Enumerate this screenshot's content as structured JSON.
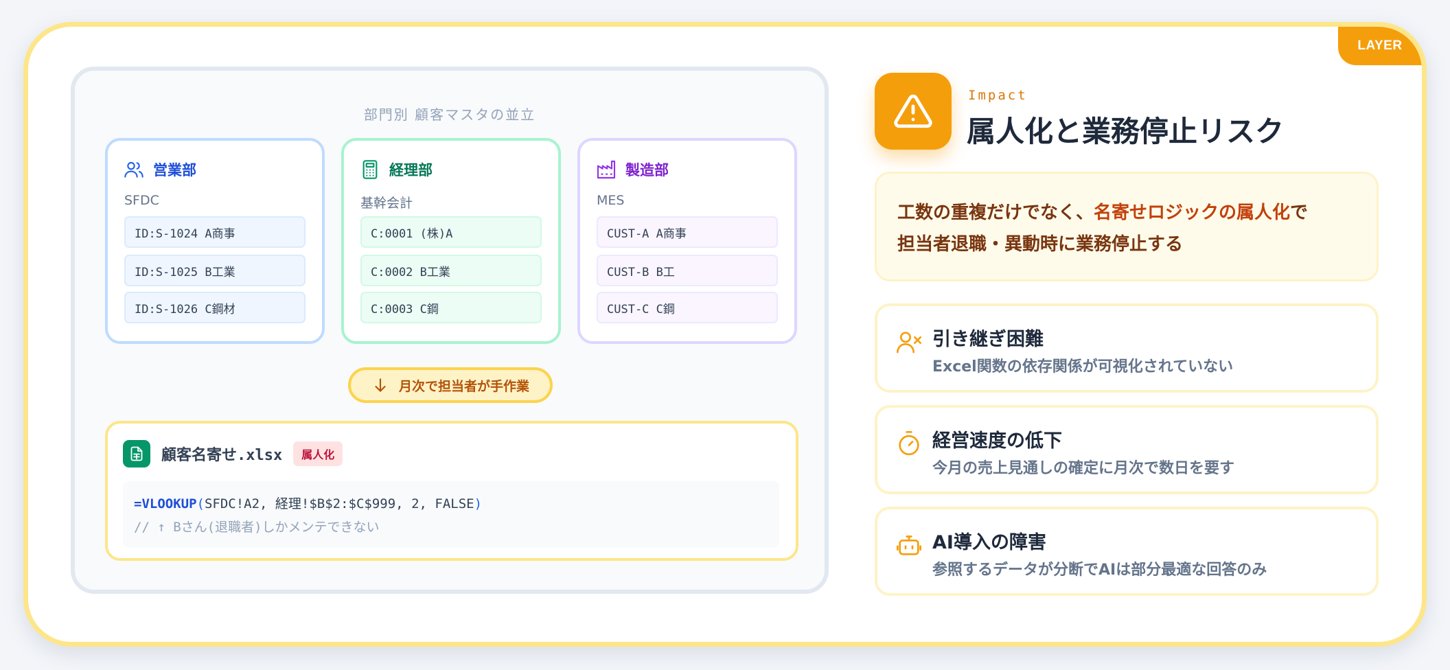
{
  "layer_tag": "LAYER",
  "left": {
    "panel_title": "部門別 顧客マスタの並立",
    "departments": [
      {
        "name": "営業部",
        "system": "SFDC",
        "records": [
          "ID:S-1024 A商事",
          "ID:S-1025 B工業",
          "ID:S-1026 C鋼材"
        ],
        "icon": "users-icon",
        "color": "#2563eb"
      },
      {
        "name": "経理部",
        "system": "基幹会計",
        "records": [
          "C:0001 (株)A",
          "C:0002 B工業",
          "C:0003 C鋼"
        ],
        "icon": "calculator-icon",
        "color": "#059669"
      },
      {
        "name": "製造部",
        "system": "MES",
        "records": [
          "CUST-A A商事",
          "CUST-B B工",
          "CUST-C C鋼"
        ],
        "icon": "factory-icon",
        "color": "#9333ea"
      }
    ],
    "manual_label": "月次で担当者が手作業",
    "xlsx": {
      "filename": "顧客名寄せ.xlsx",
      "badge": "属人化",
      "formula_fn": "=VLOOKUP",
      "formula_open": "(",
      "formula_args": "SFDC!A2, 経理!$B$2:$C$999, 2, FALSE",
      "formula_close": ")",
      "comment": "// ↑ Bさん(退職者)しかメンテできない"
    }
  },
  "right": {
    "label": "Impact",
    "title": "属人化と業務停止リスク",
    "callout": {
      "part1": "工数の重複だけでなく、",
      "highlight": "名寄せロジックの属人化",
      "part2": "で",
      "line2": "担当者退職・異動時に業務停止する"
    },
    "risks": [
      {
        "title": "引き継ぎ困難",
        "desc": "Excel関数の依存関係が可視化されていない",
        "icon": "user-x-icon"
      },
      {
        "title": "経営速度の低下",
        "desc": "今月の売上見通しの確定に月次で数日を要す",
        "icon": "timer-icon"
      },
      {
        "title": "AI導入の障害",
        "desc": "参照するデータが分断でAIは部分最適な回答のみ",
        "icon": "bot-icon"
      }
    ]
  },
  "colors": {
    "accent": "#f59e0b",
    "border": "#fde68a",
    "sales": "#2563eb",
    "accounting": "#059669",
    "manufacturing": "#9333ea"
  }
}
